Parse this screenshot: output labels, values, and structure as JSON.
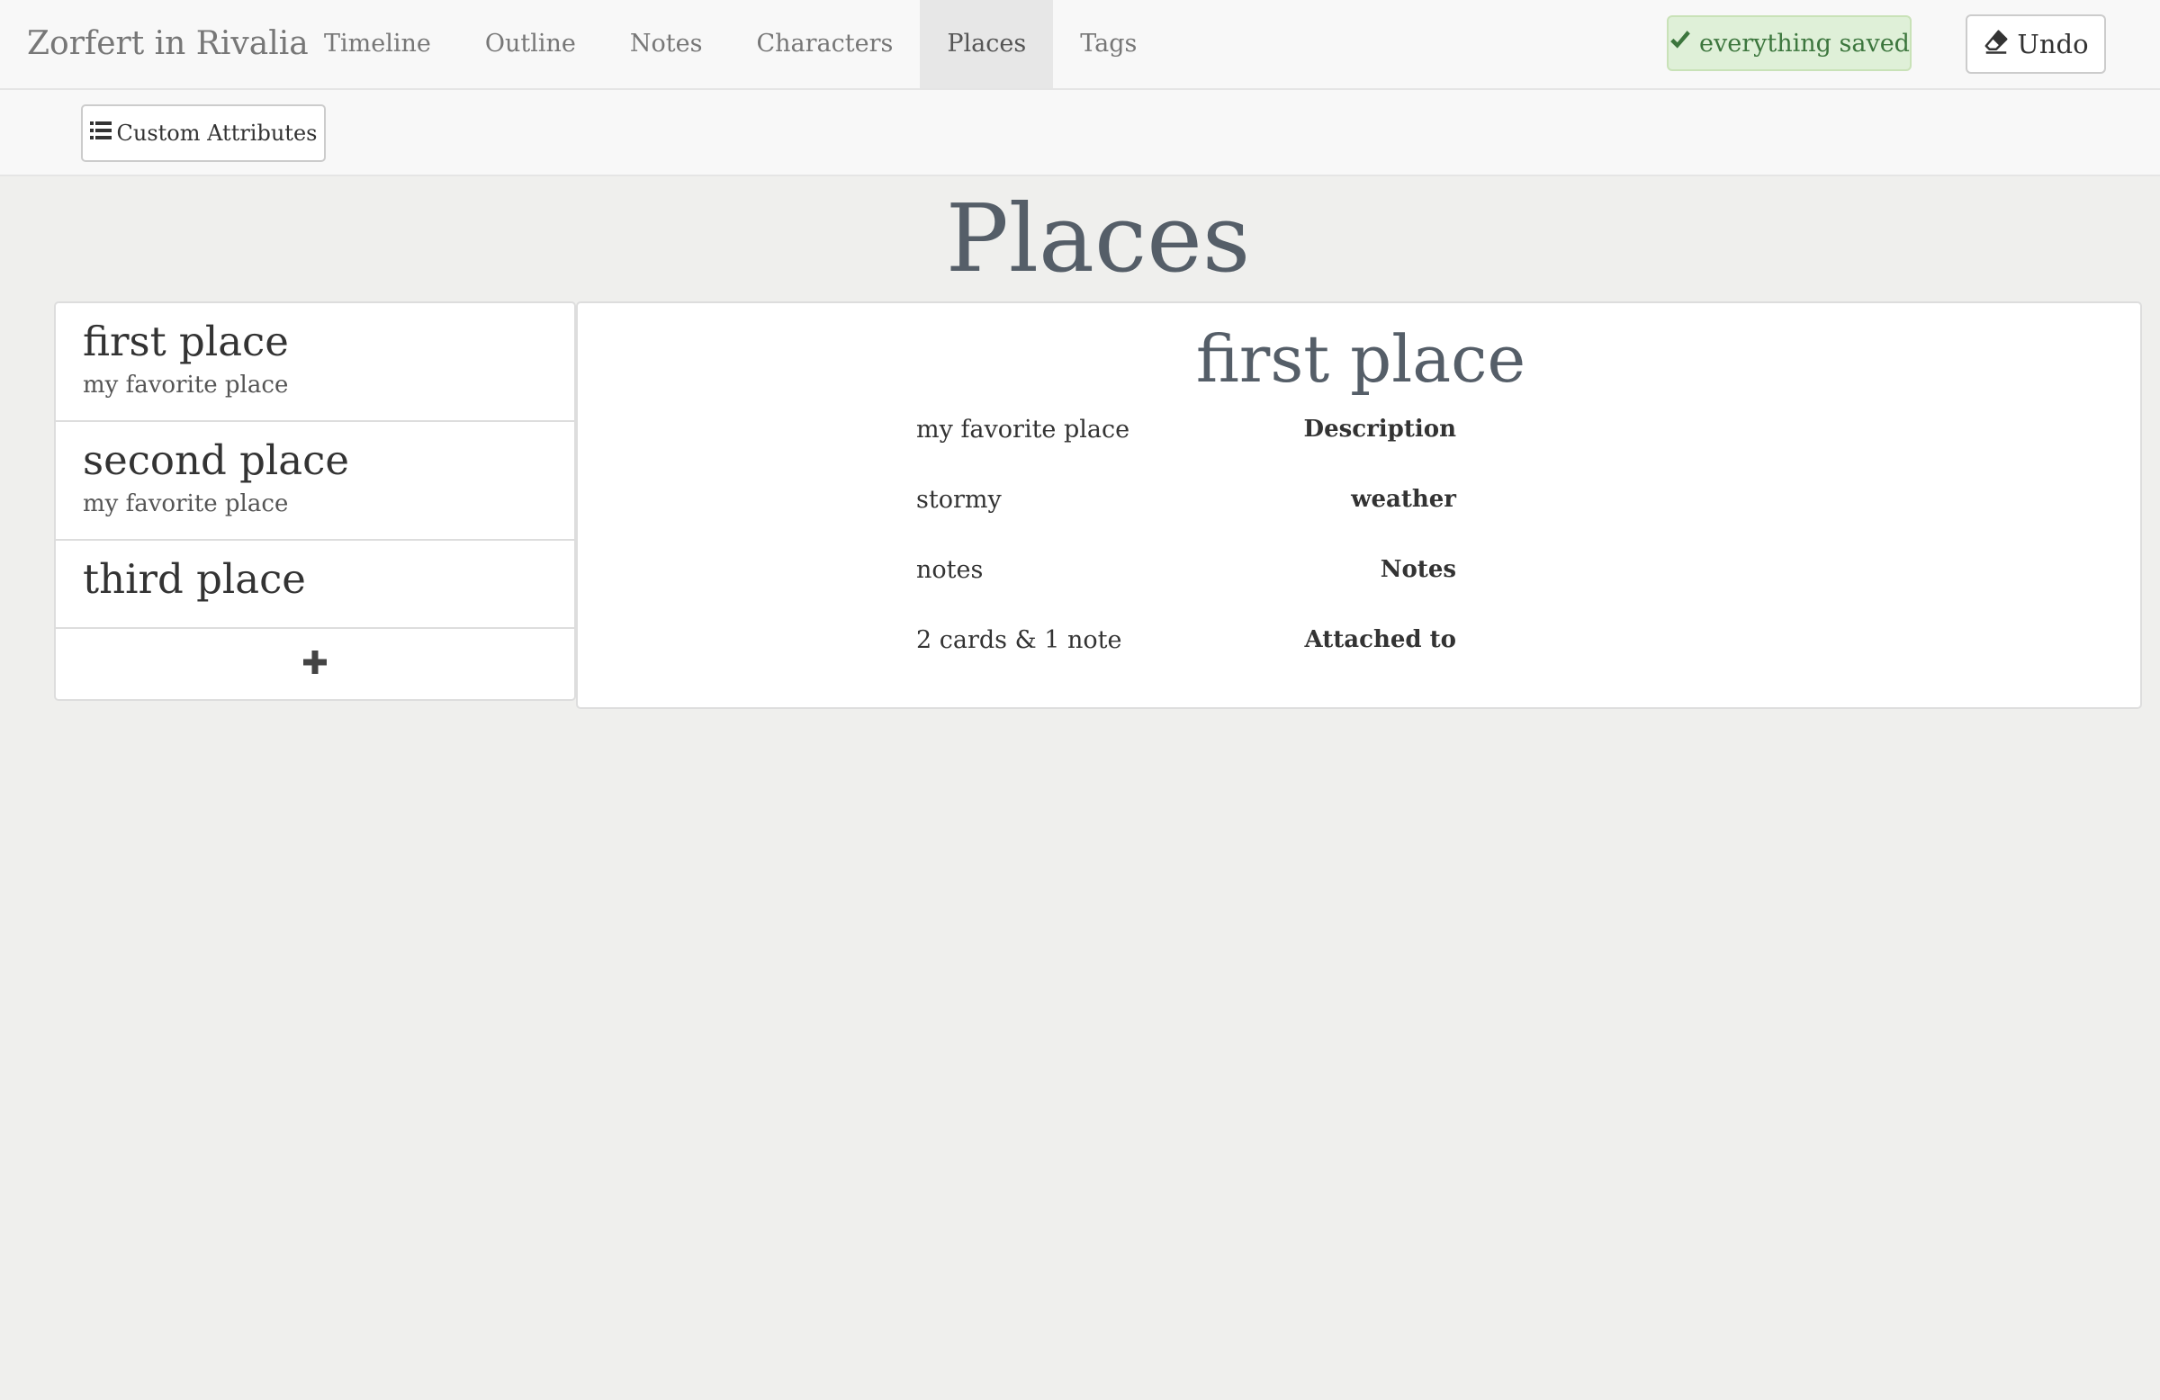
{
  "navbar": {
    "brand": "Zorfert in Rivalia",
    "tabs": [
      {
        "label": "Timeline"
      },
      {
        "label": "Outline"
      },
      {
        "label": "Notes"
      },
      {
        "label": "Characters"
      },
      {
        "label": "Places",
        "active": true
      },
      {
        "label": "Tags"
      }
    ],
    "saved_status": "everything saved",
    "undo_label": "Undo"
  },
  "toolbar": {
    "custom_attributes_label": "Custom Attributes"
  },
  "page": {
    "title": "Places"
  },
  "places": [
    {
      "name": "first place",
      "description": "my favorite place",
      "selected": true
    },
    {
      "name": "second place",
      "description": "my favorite place"
    },
    {
      "name": "third place",
      "description": ""
    }
  ],
  "detail": {
    "title": "first place",
    "attributes": [
      {
        "label": "Description",
        "value": "my favorite place"
      },
      {
        "label": "weather",
        "value": "stormy"
      },
      {
        "label": "Notes",
        "value": "notes"
      },
      {
        "label": "Attached to",
        "value": "2 cards & 1 note"
      }
    ]
  },
  "colors": {
    "background": "#efefed",
    "navbar": "#f8f8f8",
    "active_tab": "#e7e7e7",
    "saved_bg": "#dff0d8",
    "saved_text": "#3c763d",
    "title_text": "#555e68"
  },
  "icons": {
    "saved": "check-icon",
    "undo": "eraser-icon",
    "custom_attributes": "list-icon",
    "add": "plus-icon"
  }
}
